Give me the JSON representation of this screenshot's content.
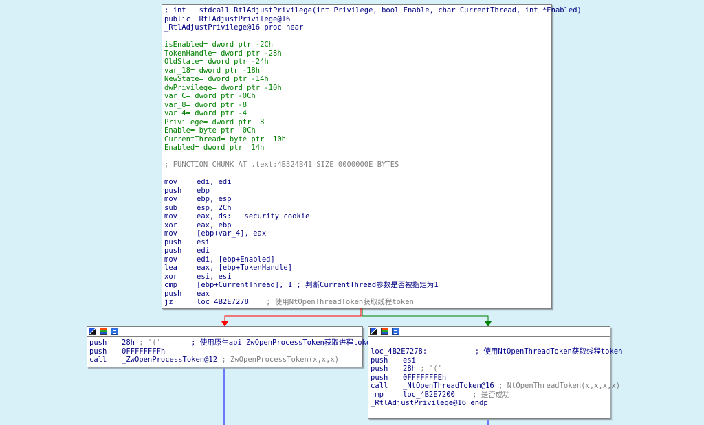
{
  "colors": {
    "background": "#d8f1f9",
    "edge_false": "#ff0000",
    "edge_true": "#008000",
    "edge_down": "#0000ff"
  },
  "icons": [
    "graph-overview-icon",
    "color-node-icon",
    "text-view-icon"
  ],
  "main_block": {
    "header": [
      "; int __stdcall RtlAdjustPrivilege(int Privilege, bool Enable, char CurrentThread, int *Enabled)",
      "public _RtlAdjustPrivilege@16",
      "_RtlAdjustPrivilege@16 proc near"
    ],
    "vars": [
      "isEnabled= dword ptr -2Ch",
      "TokenHandle= dword ptr -28h",
      "OldState= dword ptr -24h",
      "var_18= dword ptr -18h",
      "NewState= dword ptr -14h",
      "dwPrivilege= dword ptr -10h",
      "var_C= dword ptr -0Ch",
      "var_8= dword ptr -8",
      "var_4= dword ptr -4",
      "Privilege= dword ptr  8",
      "Enable= byte ptr  0Ch",
      "CurrentThread= byte ptr  10h",
      "Enabled= dword ptr  14h"
    ],
    "chunk_comment": "; FUNCTION CHUNK AT .text:4B324B41 SIZE 0000000E BYTES",
    "instructions": [
      {
        "mn": "mov",
        "op": "edi, edi"
      },
      {
        "mn": "push",
        "op": "ebp"
      },
      {
        "mn": "mov",
        "op": "ebp, esp"
      },
      {
        "mn": "sub",
        "op": "esp, 2Ch"
      },
      {
        "mn": "mov",
        "op": "eax, ds:___security_cookie"
      },
      {
        "mn": "xor",
        "op": "eax, ebp"
      },
      {
        "mn": "mov",
        "op": "[ebp+var_4], eax"
      },
      {
        "mn": "push",
        "op": "esi"
      },
      {
        "mn": "push",
        "op": "edi"
      },
      {
        "mn": "mov",
        "op": "edi, [ebp+Enabled]"
      },
      {
        "mn": "lea",
        "op": "eax, [ebp+TokenHandle]"
      },
      {
        "mn": "xor",
        "op": "esi, esi"
      },
      {
        "mn": "cmp",
        "op": "[ebp+CurrentThread], 1 ; 判断CurrentThread参数是否被指定为1"
      },
      {
        "mn": "push",
        "op": "eax"
      },
      {
        "mn": "jz",
        "op": "loc_4B2E7278",
        "comment": "    ; 使用NtOpenThreadToken获取线程token"
      }
    ]
  },
  "left_block": {
    "instructions": [
      {
        "mn": "push",
        "op": "28h",
        "comment": " ; '('",
        "comment2": "       ; 使用原生api ZwOpenProcessToken获取进程token"
      },
      {
        "mn": "push",
        "op": "0FFFFFFFFh"
      },
      {
        "mn": "call",
        "op": "_ZwOpenProcessToken@12",
        "comment": " ; ZwOpenProcessToken(x,x,x)"
      }
    ]
  },
  "right_block": {
    "label": "loc_4B2E7278:",
    "label_comment": "           ; 使用NtOpenThreadToken获取线程token",
    "instructions": [
      {
        "mn": "push",
        "op": "esi"
      },
      {
        "mn": "push",
        "op": "28h",
        "comment": " ; '('"
      },
      {
        "mn": "push",
        "op": "0FFFFFFFEh"
      },
      {
        "mn": "call",
        "op": "_NtOpenThreadToken@16",
        "comment": " ; NtOpenThreadToken(x,x,x,x)"
      },
      {
        "mn": "jmp",
        "op": "loc_4B2E7200",
        "comment": "    ; 是否成功"
      }
    ],
    "endp": "_RtlAdjustPrivilege@16 endp"
  }
}
